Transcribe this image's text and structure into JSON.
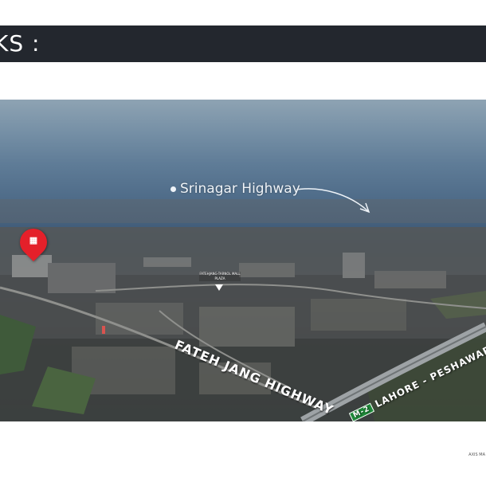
{
  "header": {
    "title": "KS :"
  },
  "photo": {
    "labels": {
      "srinagar": "Srinagar Highway",
      "fateh_jang": "FATEH JANG HIGHWAY",
      "motorway_badge": "M-2",
      "motorway": "LAHORE - PESHAWAR M",
      "plaza": "FATEHJANG-TARNOL MALL PLAZA"
    },
    "icons": {
      "location_pin": "location-pin-icon",
      "plaza_marker": "map-marker-icon",
      "arrow": "curved-arrow-icon"
    },
    "colors": {
      "pin": "#e4202a",
      "motorway_badge": "#1f8a3a"
    }
  },
  "footer": {
    "note": "AXIS MA"
  }
}
